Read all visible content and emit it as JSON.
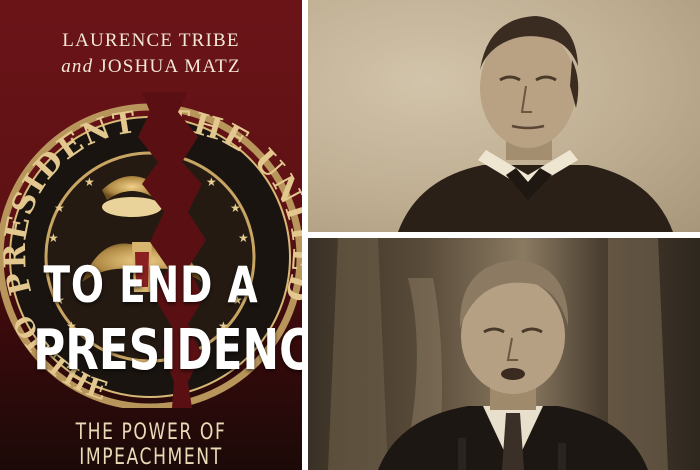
{
  "cover": {
    "author_1": "LAURENCE TRIBE",
    "author_2_and": "and",
    "author_2_name": "JOSHUA MATZ",
    "seal_text_left": "PRESIDENT",
    "seal_text_right": "THE UNITED ST",
    "seal_text_bottom": "OF THE",
    "title_line_1": "TO END A",
    "title_line_2": "PRESIDENCY",
    "subtitle": "THE POWER OF IMPEACHMENT"
  },
  "photos": {
    "top": "sepia-portrait-man-19th-century",
    "bottom": "sepia-photo-man-speaking-at-podium"
  }
}
